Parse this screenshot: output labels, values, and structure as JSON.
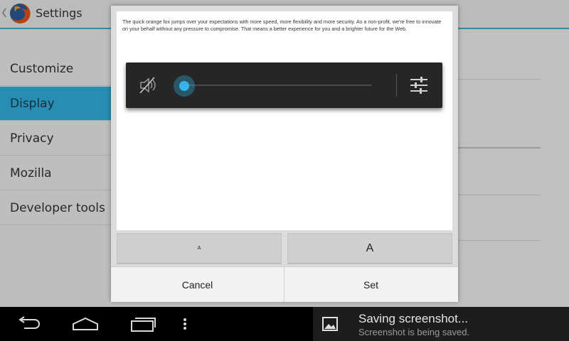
{
  "actionbar": {
    "title": "Settings"
  },
  "sidebar": {
    "items": [
      {
        "label": "Customize",
        "selected": false
      },
      {
        "label": "Display",
        "selected": true
      },
      {
        "label": "Privacy",
        "selected": false
      },
      {
        "label": "Mozilla",
        "selected": false
      },
      {
        "label": "Developer tools",
        "selected": false
      }
    ]
  },
  "dialog": {
    "preview_text": "The quick orange fox jumps over your expectations with more speed, more flexibility and more security. As a non-profit, we're free to innovate on your behalf without any pressure to compromise. That means a better experience for you and a brighter future for the Web.",
    "volume": {
      "level_fraction": 0.0,
      "muted": true
    },
    "size_buttons": {
      "small_label": "A",
      "large_label": "A"
    },
    "cancel_label": "Cancel",
    "set_label": "Set"
  },
  "notification": {
    "title": "Saving screenshot...",
    "subtitle": "Screenshot is being saved."
  },
  "colors": {
    "accent": "#33b5e5",
    "navbar": "#000000",
    "volume_panel": "#262626"
  },
  "icons": {
    "back": "chevron-left-icon",
    "app": "firefox-logo-icon",
    "mute": "speaker-muted-icon",
    "settings": "sliders-icon",
    "nav_back": "back-arrow-icon",
    "nav_home": "home-icon",
    "nav_recents": "recent-apps-icon",
    "nav_menu": "overflow-menu-icon",
    "notif": "image-icon"
  }
}
